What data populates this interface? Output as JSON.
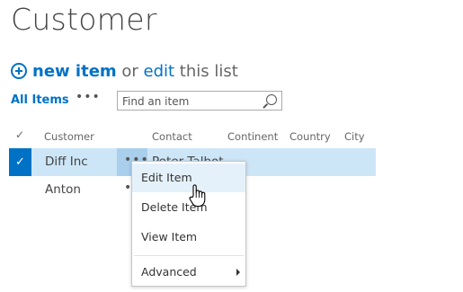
{
  "page": {
    "title": "Customer"
  },
  "actions": {
    "new_item": "new item",
    "or": " or ",
    "edit": "edit",
    "this_list": " this list"
  },
  "views": {
    "current": "All Items",
    "more": "•••"
  },
  "search": {
    "placeholder": "Find an item"
  },
  "table": {
    "columns": [
      "Customer",
      "Contact",
      "Continent",
      "Country",
      "City"
    ],
    "check_glyph": "✓",
    "rows": [
      {
        "customer": "Diff Inc",
        "contact": "Peter Talbot",
        "selected": true
      },
      {
        "customer": "Anton",
        "contact": "",
        "selected": false
      }
    ],
    "row_more": "•••"
  },
  "context_menu": {
    "items": [
      "Edit Item",
      "Delete Item",
      "View Item",
      "Advanced"
    ],
    "hovered": "Edit Item"
  },
  "colors": {
    "accent": "#0072c6",
    "row_selected": "#cde6f7",
    "menu_hover": "#e5f1fa"
  },
  "icons": [
    "plus-circle-icon",
    "search-icon",
    "checkmark-icon",
    "hand-cursor-icon",
    "submenu-arrow-icon"
  ]
}
